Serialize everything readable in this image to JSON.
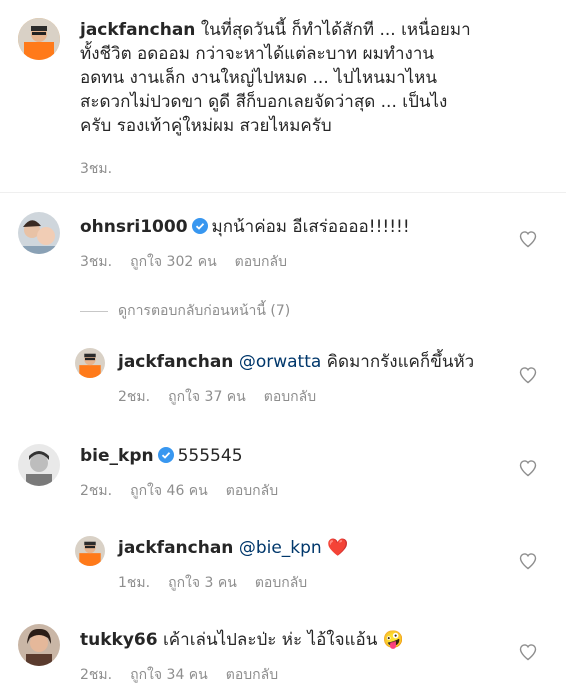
{
  "caption": {
    "username": "jackfanchan",
    "lines": [
      "ในที่สุดวันนี้ ก็ทำได้สักที ... เหนื่อยมา",
      "ทั้งชีวิต อดออม กว่าจะหาได้แต่ละบาท ผมทำงาน",
      "อดทน งานเล็ก งานใหญ่ไปหมด ... ไปไหนมาไหน",
      "สะดวกไม่ปวดขา ดูดี สีก็บอกเลยจัดว่าสุด ... เป็นไง",
      "ครับ รองเท้าคู่ใหม่ผม สวยไหมครับ"
    ],
    "time": "3ชม."
  },
  "comments": [
    {
      "username": "ohnsri1000",
      "verified": true,
      "text": "มุกน้าค่อม อีเสร่ออออ!!!!!!",
      "time": "3ชม.",
      "likes": "ถูกใจ 302 คน",
      "reply": "ตอบกลับ",
      "view_previous": "ดูการตอบกลับก่อนหน้านี้ (7)",
      "replies": [
        {
          "username": "jackfanchan",
          "mention": "@orwatta",
          "text": " คิดมากรังแคก็ขึ้นหัว",
          "time": "2ชม.",
          "likes": "ถูกใจ 37 คน",
          "reply": "ตอบกลับ"
        }
      ]
    },
    {
      "username": "bie_kpn",
      "verified": true,
      "text": "555545",
      "time": "2ชม.",
      "likes": "ถูกใจ 46 คน",
      "reply": "ตอบกลับ",
      "replies": [
        {
          "username": "jackfanchan",
          "mention": "@bie_kpn",
          "text": " ❤️",
          "time": "1ชม.",
          "likes": "ถูกใจ 3 คน",
          "reply": "ตอบกลับ"
        }
      ]
    },
    {
      "username": "tukky66",
      "verified": false,
      "text": "เค้าเล่นไปละป่ะ ห่ะ ไอ้ใจแอ้น 🤪",
      "time": "2ชม.",
      "likes": "ถูกใจ 34 คน",
      "reply": "ตอบกลับ"
    }
  ],
  "colors": {
    "text": "#262626",
    "meta": "#8e8e8e",
    "mention": "#00376b",
    "verified": "#3897f0",
    "heart_outline": "#8e8e8e"
  }
}
